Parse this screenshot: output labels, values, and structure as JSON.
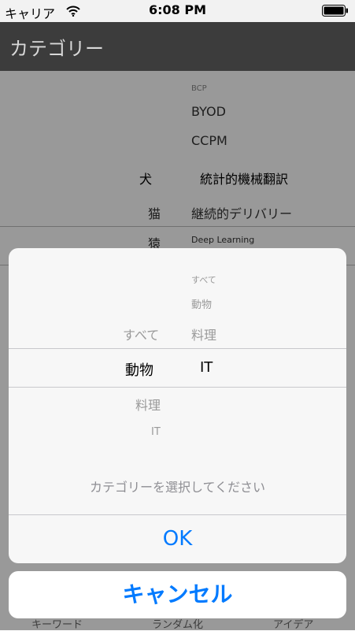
{
  "status_bar": {
    "carrier": "キャリア",
    "time": "6:08 PM"
  },
  "nav": {
    "title": "カテゴリー"
  },
  "background_picker": {
    "left_column": {
      "above": [
        "猫",
        "猿"
      ],
      "selected": "犬"
    },
    "right_column": {
      "above": [
        "BCP",
        "BYOD",
        "CCPM"
      ],
      "selected": "統計的機械翻訳",
      "below": [
        "継続的デリバリー",
        "Deep Learning"
      ]
    }
  },
  "background_tabs": [
    "キーワード",
    "ランダム化",
    "アイデア"
  ],
  "category_picker": {
    "left_column": {
      "above": [
        "すべて"
      ],
      "selected": "動物",
      "below": [
        "料理",
        "IT"
      ]
    },
    "right_column": {
      "above": [
        "すべて",
        "動物",
        "料理"
      ],
      "selected": "IT"
    }
  },
  "sheet": {
    "message": "カテゴリーを選択してください",
    "ok_label": "OK"
  },
  "cancel_label": "キャンセル",
  "colors": {
    "accent": "#007aff",
    "nav_bg": "#3c3c3c"
  }
}
